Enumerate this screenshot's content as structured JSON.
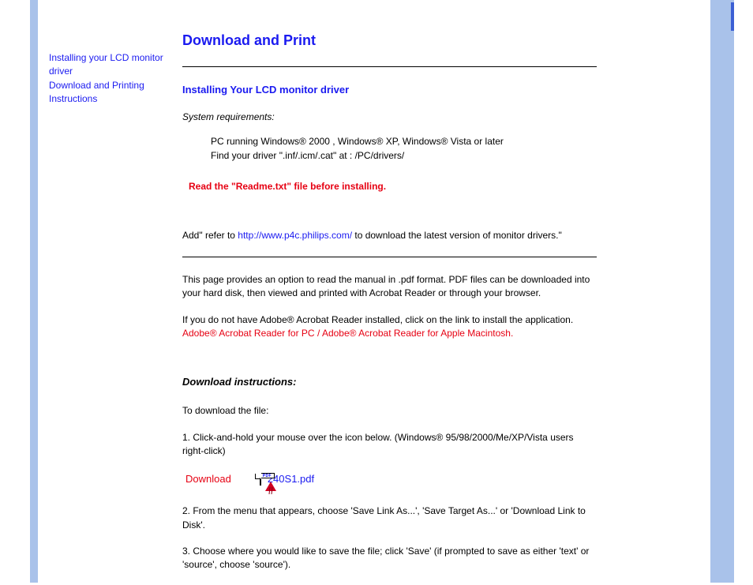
{
  "sidebar": {
    "items": [
      {
        "label": "Installing your LCD monitor driver"
      },
      {
        "label": "Download and Printing Instructions"
      }
    ]
  },
  "page": {
    "title": "Download and Print",
    "section1_title": "Installing Your LCD monitor driver",
    "sysreq_label": "System requirements:",
    "req1": "PC running Windows® 2000 , Windows® XP, Windows® Vista or later",
    "req2": "Find your driver \".inf/.icm/.cat\" at : /PC/drivers/",
    "warning": "Read the \"Readme.txt\" file before installing.",
    "add_pre": "Add\" refer to ",
    "add_link": "http://www.p4c.philips.com/",
    "add_post": " to download the latest version of monitor drivers.\"",
    "intro1": "This page provides an option to read the manual in .pdf format. PDF files can be downloaded into your hard disk, then viewed and printed with Acrobat Reader or through your browser.",
    "intro2_pre": "If you do not have Adobe® Acrobat Reader installed, click on the link to install the application. ",
    "acro_pc": "Adobe® Acrobat Reader for PC",
    "sep": " / ",
    "acro_mac": "Adobe® Acrobat Reader for Apple Macintosh",
    "period": ".",
    "dl_heading": "Download instructions:",
    "dl_lead": "To download the file:",
    "step1": "1. Click-and-hold your mouse over the icon below. (Windows® 95/98/2000/Me/XP/Vista users right-click)",
    "dl_label": "Download",
    "pdf_name": "240S1.pdf",
    "pdf_tag": "PDF",
    "step2": "2. From the menu that appears, choose 'Save Link As...', 'Save Target As...' or 'Download Link to Disk'.",
    "step3": "3. Choose where you would like to save the file; click 'Save' (if prompted to save as either 'text' or 'source', choose 'source')."
  }
}
